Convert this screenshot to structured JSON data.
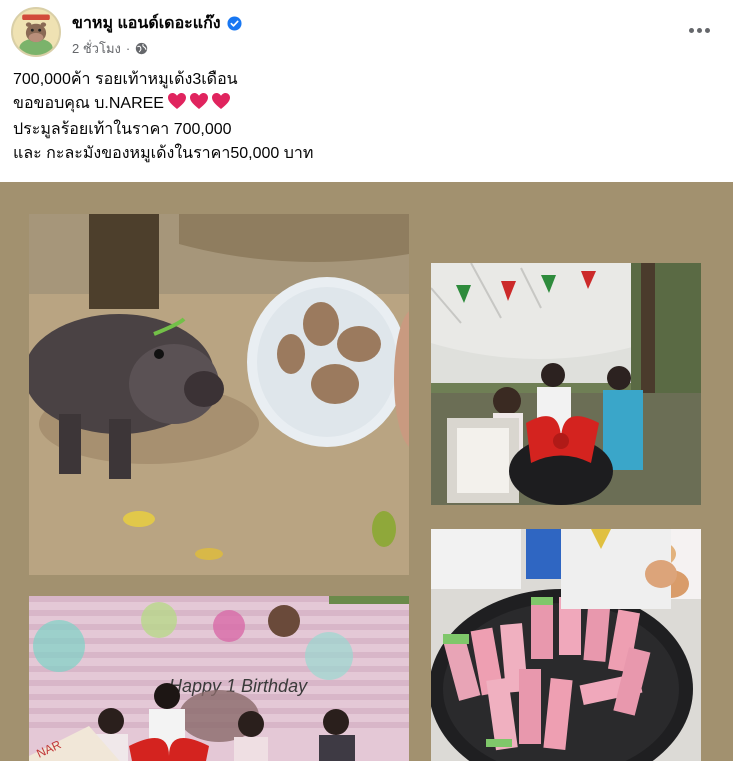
{
  "post": {
    "author": "ขาหมู แอนด์เดอะแก๊ง",
    "verified": true,
    "time": "2 ชั่วโมง",
    "separator": "·",
    "privacy_icon": "globe-icon",
    "more_icon": "more-options-icon",
    "text_lines": [
      "700,000ค้า รอยเท้าหมูเด้ง3เดือน",
      "ขอขอบคุณ บ.NAREE",
      "ประมูลร้อยเท้าในราคา 700,000",
      "และ กะละมังของหมูเด้งในราคา50,000 บาท"
    ],
    "hearts": [
      "heart-icon",
      "heart-icon",
      "heart-icon"
    ]
  },
  "banner": {
    "birthday_text": "Happy 1 Birthday",
    "brand_text": "NAR"
  },
  "colors": {
    "media_background": "#a2916f",
    "verified_blue": "#1877f2",
    "heart_red": "#e0245e",
    "meta_gray": "#65676b"
  }
}
